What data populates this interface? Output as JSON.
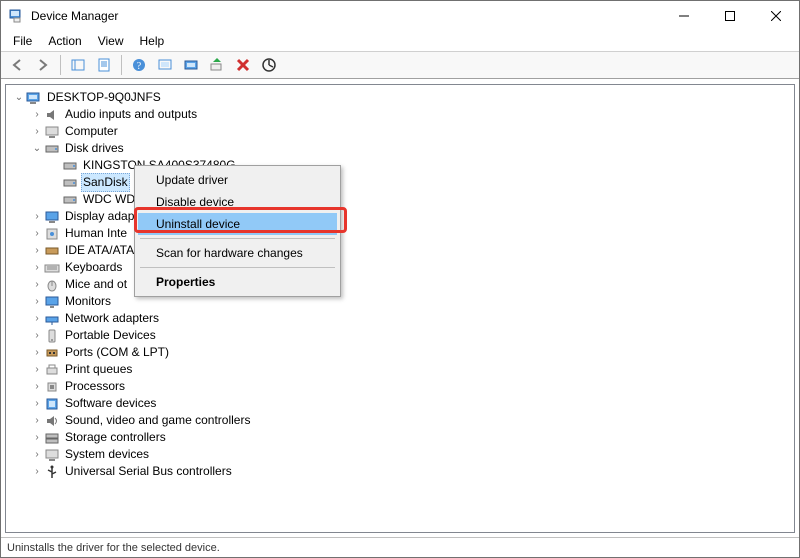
{
  "window": {
    "title": "Device Manager"
  },
  "menu": {
    "file": "File",
    "action": "Action",
    "view": "View",
    "help": "Help"
  },
  "toolbar_icons": {
    "back": "back-icon",
    "forward": "forward-icon",
    "show_hidden": "show-hidden-icon",
    "properties": "properties-icon",
    "help": "help-icon",
    "action_center": "action-center-icon",
    "scan": "scan-hardware-icon",
    "enable": "enable-device-icon",
    "uninstall": "uninstall-device-icon",
    "update": "update-driver-icon"
  },
  "tree": {
    "root": "DESKTOP-9Q0JNFS",
    "disk_drives": {
      "label": "Disk drives",
      "items": [
        "KINGSTON SA400S37480G",
        "SanDisk",
        "WDC WD"
      ]
    },
    "categories": [
      "Audio inputs and outputs",
      "Computer",
      "Display adap",
      "Human Inte",
      "IDE ATA/ATA",
      "Keyboards",
      "Mice and ot",
      "Monitors",
      "Network adapters",
      "Portable Devices",
      "Ports (COM & LPT)",
      "Print queues",
      "Processors",
      "Software devices",
      "Sound, video and game controllers",
      "Storage controllers",
      "System devices",
      "Universal Serial Bus controllers"
    ]
  },
  "context_menu": {
    "update_driver": "Update driver",
    "disable_device": "Disable device",
    "uninstall_device": "Uninstall device",
    "scan": "Scan for hardware changes",
    "properties": "Properties"
  },
  "statusbar": {
    "text": "Uninstalls the driver for the selected device."
  }
}
